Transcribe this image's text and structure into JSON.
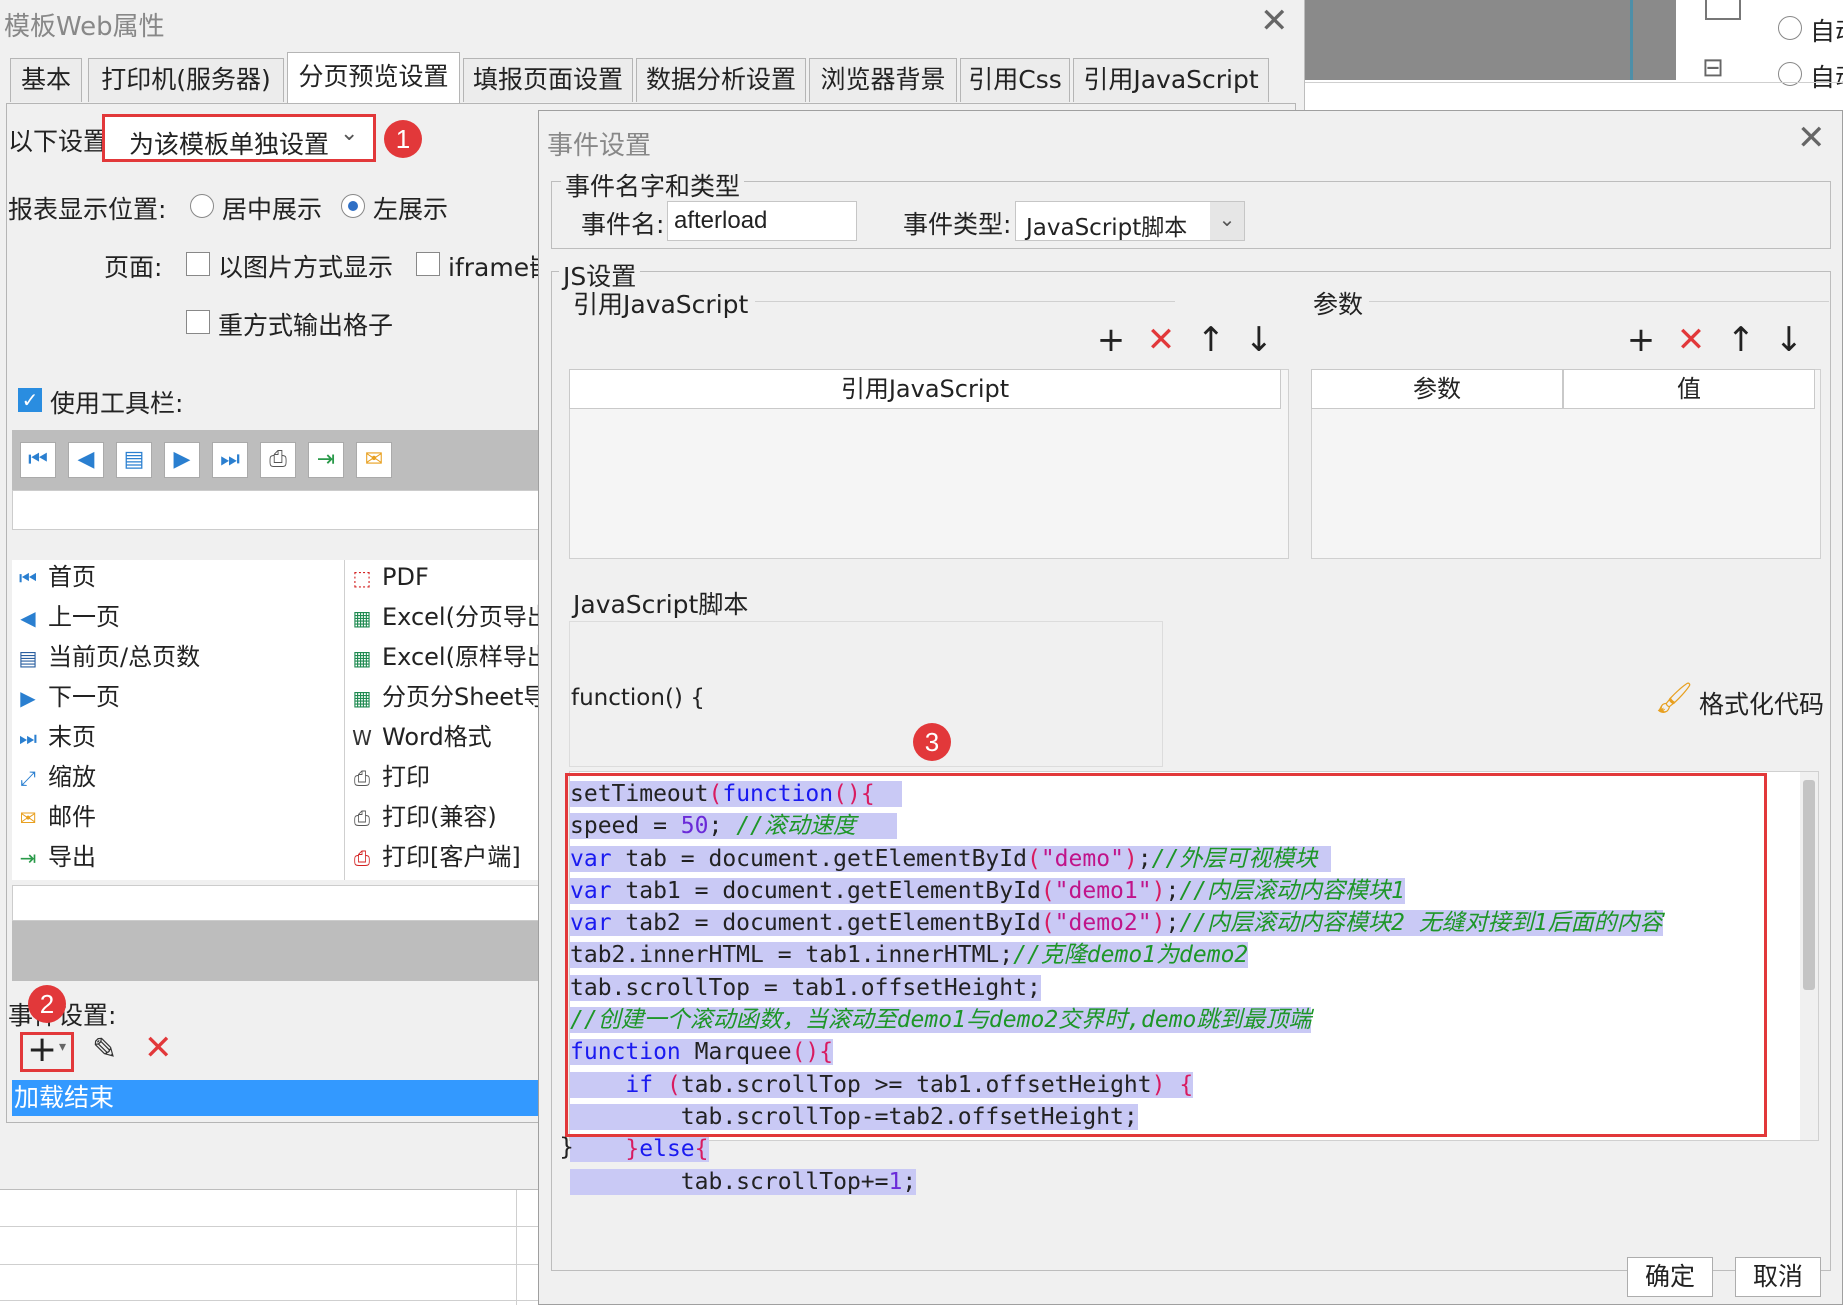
{
  "background": {
    "radio_options": [
      "自动",
      "自动"
    ]
  },
  "main_window": {
    "title": "模板Web属性",
    "tabs": [
      {
        "label": "基本"
      },
      {
        "label": "打印机(服务器)"
      },
      {
        "label": "分页预览设置"
      },
      {
        "label": "填报页面设置"
      },
      {
        "label": "数据分析设置"
      },
      {
        "label": "浏览器背景"
      },
      {
        "label": "引用Css"
      },
      {
        "label": "引用JavaScript"
      }
    ],
    "settings_label": "以下设置:",
    "settings_value": "为该模板单独设置",
    "display_position_label": "报表显示位置:",
    "center_label": "居中展示",
    "left_label": "左展示",
    "page_label": "页面:",
    "image_mode_label": "以图片方式显示",
    "iframe_label": "iframe嵌",
    "output_grid_label": "重方式输出格子",
    "use_toolbar_label": "使用工具栏:",
    "toolbar_list_left": [
      "首页",
      "上一页",
      "当前页/总页数",
      "下一页",
      "末页",
      "缩放",
      "邮件",
      "导出"
    ],
    "toolbar_list_right": [
      "PDF",
      "Excel(分页导出",
      "Excel(原样导出",
      "分页分Sheet导",
      "Word格式",
      "打印",
      "打印(兼容)",
      "打印[客户端]"
    ],
    "event_settings_label": "事件设置:",
    "event_item": "加载结束"
  },
  "badges": [
    "1",
    "2",
    "3"
  ],
  "dialog": {
    "title": "事件设置",
    "name_type_legend": "事件名字和类型",
    "event_name_label": "事件名:",
    "event_name_value": "afterload",
    "event_type_label": "事件类型:",
    "event_type_value": "JavaScript脚本",
    "js_legend": "JS设置",
    "ref_js_title": "引用JavaScript",
    "ref_js_column": "引用JavaScript",
    "params_title": "参数",
    "param_columns": [
      "参数",
      "值"
    ],
    "script_label": "JavaScript脚本",
    "function_header": "function() {",
    "format_code_label": "格式化代码",
    "closing_brace": "}",
    "ok_label": "确定",
    "cancel_label": "取消"
  },
  "colors": {
    "highlight_red": "#e2383a",
    "selection_blue": "#3399ff",
    "code_highlight": "#c9c9f5"
  }
}
